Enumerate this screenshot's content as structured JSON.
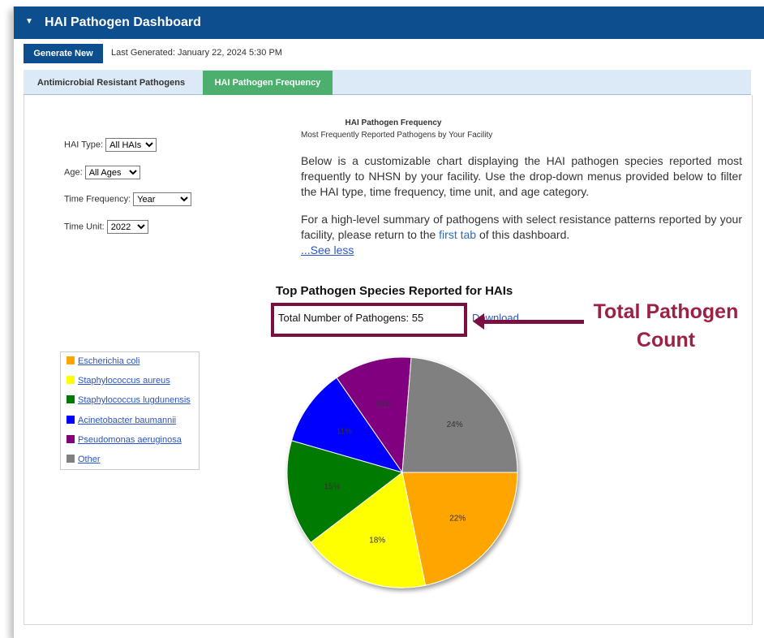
{
  "dashboard": {
    "title": "HAI Pathogen Dashboard",
    "generate_button": "Generate New",
    "last_generated": "Last Generated: January 22, 2024 5:30 PM"
  },
  "tabs": [
    {
      "label": "Antimicrobial Resistant Pathogens",
      "active": false
    },
    {
      "label": "HAI Pathogen Frequency",
      "active": true
    }
  ],
  "filters": {
    "hai_type": {
      "label": "HAI Type:",
      "value": "All HAIs"
    },
    "age": {
      "label": "Age:",
      "value": "All Ages"
    },
    "time_frequency": {
      "label": "Time Frequency:",
      "value": "Year"
    },
    "time_unit": {
      "label": "Time Unit:",
      "value": "2022"
    }
  },
  "panel": {
    "heading": "HAI Pathogen Frequency",
    "subheading": "Most Frequently Reported Pathogens by Your Facility",
    "description_1": "Below is a customizable chart displaying the HAI pathogen species reported most frequently to NHSN by your facility. Use the drop-down menus provided below to filter the HAI type, time frequency, time unit, and age category.",
    "description_2_before": "For a high-level summary of pathogens with select resistance patterns reported by your facility, please return to the",
    "description_2_link": "first tab",
    "description_2_after": "of this dashboard.",
    "see_less": "...See less"
  },
  "chart_title": "Top Pathogen Species Reported for HAIs",
  "total_pathogens": "Total Number of Pathogens: 55",
  "download_link": "Download",
  "callout": {
    "line1": "Total Pathogen",
    "line2": "Count",
    "color": "#9c2244"
  },
  "chart_data": {
    "type": "pie",
    "title": "Top Pathogen Species Reported for HAIs",
    "slices": [
      {
        "label": "Escherichia coli",
        "value": 22,
        "display": "22%",
        "color": "#ffa500"
      },
      {
        "label": "Staphylococcus aureus",
        "value": 18,
        "display": "18%",
        "color": "#ffff00"
      },
      {
        "label": "Staphylococcus lugdunensis",
        "value": 15,
        "display": "15%",
        "color": "#007a00"
      },
      {
        "label": "Acinetobacter baumannii",
        "value": 11,
        "display": "11%",
        "color": "#0000ff"
      },
      {
        "label": "Pseudomonas aeruginosa",
        "value": 11,
        "display": "11%",
        "color": "#800080"
      },
      {
        "label": "Other",
        "value": 24,
        "display": "24%",
        "color": "#808080"
      }
    ],
    "legend_position": "left"
  }
}
